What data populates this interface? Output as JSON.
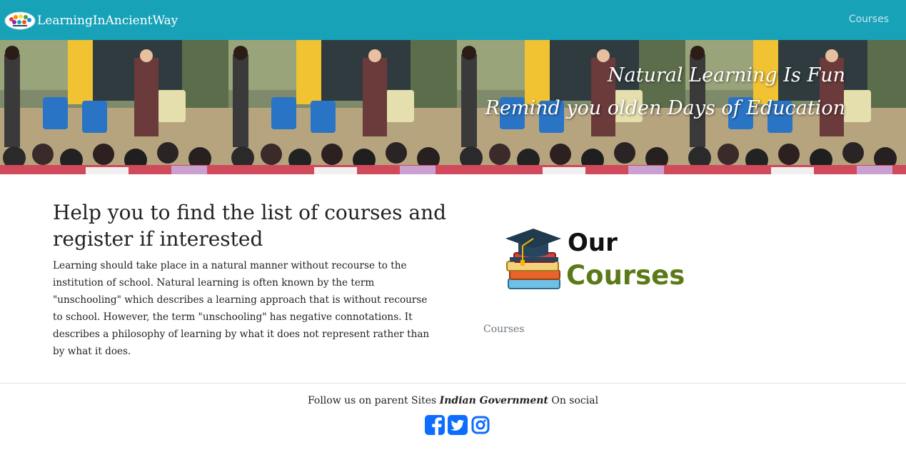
{
  "navbar": {
    "brand": "LearningInAncientWay",
    "brand_logo_icon": "colorful-speech-bubble-logo",
    "links": [
      {
        "label": "Courses"
      }
    ],
    "background": "#17a2b8"
  },
  "hero": {
    "line1": "Natural Learning Is Fun",
    "line2": "Remind you olden Days of Education"
  },
  "main": {
    "heading": "Help you to find the list of courses and register if interested",
    "paragraph": "Learning should take place in a natural manner without recourse to the institution of school. Natural learning is often known by the term \"unschooling\" which describes a learning approach that is without recourse to school. However, the term \"unschooling\" has negative connotations. It describes a philosophy of learning by what it does not represent rather than by what it does.",
    "courses_graphic": {
      "word1": "Our",
      "word2": "Courses",
      "icon": "graduation-cap-books-icon",
      "accent": "#5b7a17"
    },
    "courses_link": "Courses"
  },
  "footer": {
    "prefix": "Follow us on parent Sites ",
    "emphasis": "Indian Government",
    "suffix": " On social",
    "social_icons": [
      "facebook-icon",
      "twitter-icon",
      "instagram-icon"
    ],
    "icon_color": "#0d6efd"
  }
}
